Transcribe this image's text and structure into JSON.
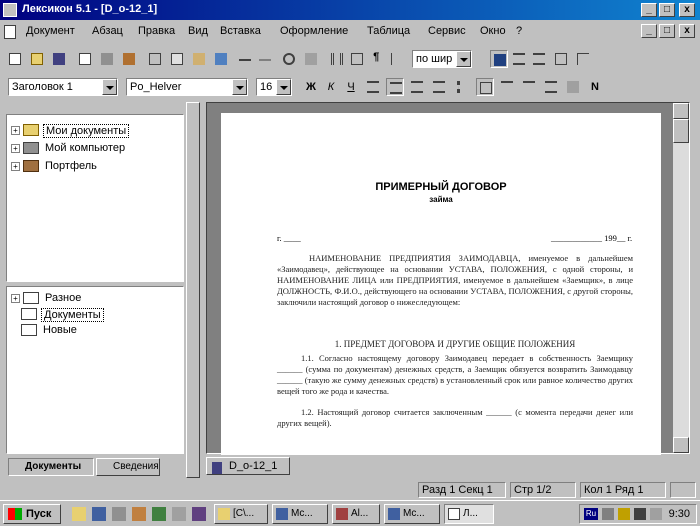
{
  "window": {
    "title": "Лексикон 5.1 - [D_o-12_1]",
    "buttons": [
      "_",
      "□",
      "x"
    ]
  },
  "menu": [
    "Документ",
    "Абзац",
    "Правка",
    "Вид",
    "Вставка",
    "Оформление",
    "Таблица",
    "Сервис",
    "Окно",
    "?"
  ],
  "toolbar1": {
    "zoom_value": "по шир"
  },
  "toolbar2": {
    "style_value": "Заголовок 1",
    "font_value": "Po_Helver",
    "size_value": "16",
    "format_buttons": [
      "Ж",
      "К",
      "Ч",
      "N"
    ]
  },
  "tree_top": [
    {
      "label": "Мои документы",
      "selected": true
    },
    {
      "label": "Мой компьютер",
      "selected": false
    },
    {
      "label": "Портфель",
      "selected": false
    }
  ],
  "tree_bottom": [
    {
      "label": "Разное",
      "selected": false
    },
    {
      "label": "Документы",
      "selected": true
    },
    {
      "label": "Новые",
      "selected": false
    }
  ],
  "left_tabs": [
    "Документы",
    "Сведения"
  ],
  "document": {
    "title": "ПРИМЕРНЫЙ ДОГОВОР",
    "subtitle": "займа",
    "city": "г. ____",
    "date": "____________ 199__ г.",
    "para_intro": "НАИМЕНОВАНИЕ ПРЕДПРИЯТИЯ ЗАИМОДАВЦА, именуемое в дальнейшем «Заимодавец», действующее на основании УСТАВА, ПОЛОЖЕНИЯ, с одной стороны, и НАИМЕНОВАНИЕ ЛИЦА или ПРЕДПРИЯТИЯ, именуемое в дальнейшем «Заемщик», в лице ДОЛЖНОСТЬ, Ф.И.О., действующего на основании УСТАВА, ПОЛОЖЕНИЯ, с другой стороны, заключили настоящий договор о нижеследующем:",
    "section1": "1. ПРЕДМЕТ ДОГОВОРА И ДРУГИЕ ОБЩИЕ ПОЛОЖЕНИЯ",
    "para_1_1": "1.1. Согласно настоящему договору Заимодавец передает в собственность Заемщику ______ (сумма по документам) денежных средств, а Заемщик обязуется возвратить Заимодавцу ______ (такую же сумму денежных средств) в установленный срок или равное количество других вещей того же рода и качества.",
    "para_1_2": "1.2. Настоящий договор считается заключенным ______ (с момента передачи денег или других вещей)."
  },
  "doc_tab": "D_o-12_1",
  "status": {
    "section": "Разд 1 Секц 1",
    "page": "Стр 1/2",
    "line": "Кол 1 Ряд 1"
  },
  "taskbar": {
    "start_label": "Пуск",
    "tasks": [
      "[C\\...",
      "Mc...",
      "Al...",
      "Mc...",
      "Л..."
    ],
    "clock": "9:30"
  },
  "colors": {
    "titlebar_start": "#000080",
    "titlebar_end": "#1084d0",
    "face": "#c0c0c0"
  }
}
